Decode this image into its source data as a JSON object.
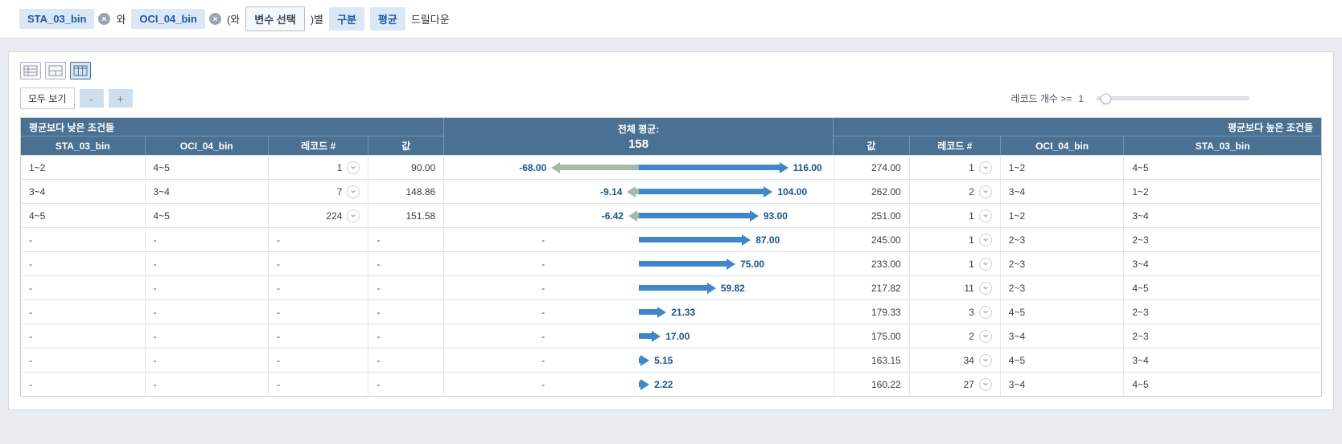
{
  "query_bar": {
    "variables": [
      {
        "label": "STA_03_bin"
      },
      {
        "label": "OCI_04_bin"
      }
    ],
    "conjunction": "와",
    "open_paren": "(와",
    "variable_select_label": "변수 선택",
    "close_paren_suffix": ")별",
    "split_label": "구분",
    "aggregate_label": "평균",
    "mode_label": "드릴다운"
  },
  "toolbar": {
    "view_all_label": "모두 보기",
    "zoom_out_label": "-",
    "zoom_in_label": "+",
    "record_filter_label": "레코드 개수 >=",
    "record_filter_value": "1"
  },
  "view_switcher": {
    "icons": [
      "table-view-icon",
      "split-view-icon",
      "column-view-icon"
    ],
    "selected_index": 2
  },
  "table": {
    "left_group_title": "평균보다 낮은 조건들",
    "right_group_title": "평균보다 높은 조건들",
    "center_header_title": "전체 평균:",
    "center_header_value": "158",
    "left_columns": [
      "STA_03_bin",
      "OCI_04_bin",
      "레코드 #",
      "값"
    ],
    "right_columns": [
      "값",
      "레코드 #",
      "OCI_04_bin",
      "STA_03_bin"
    ],
    "rows": [
      {
        "left": [
          "1~2",
          "4~5",
          "1",
          "90.00"
        ],
        "neg": "-68.00",
        "pos": "116.00",
        "right": [
          "274.00",
          "1",
          "1~2",
          "4~5"
        ]
      },
      {
        "left": [
          "3~4",
          "3~4",
          "7",
          "148.86"
        ],
        "neg": "-9.14",
        "pos": "104.00",
        "right": [
          "262.00",
          "2",
          "3~4",
          "1~2"
        ]
      },
      {
        "left": [
          "4~5",
          "4~5",
          "224",
          "151.58"
        ],
        "neg": "-6.42",
        "pos": "93.00",
        "right": [
          "251.00",
          "1",
          "1~2",
          "3~4"
        ]
      },
      {
        "left": [
          "-",
          "-",
          "-",
          "-"
        ],
        "neg": "-",
        "pos": "87.00",
        "right": [
          "245.00",
          "1",
          "2~3",
          "2~3"
        ]
      },
      {
        "left": [
          "-",
          "-",
          "-",
          "-"
        ],
        "neg": "-",
        "pos": "75.00",
        "right": [
          "233.00",
          "1",
          "2~3",
          "3~4"
        ]
      },
      {
        "left": [
          "-",
          "-",
          "-",
          "-"
        ],
        "neg": "-",
        "pos": "59.82",
        "right": [
          "217.82",
          "11",
          "2~3",
          "4~5"
        ]
      },
      {
        "left": [
          "-",
          "-",
          "-",
          "-"
        ],
        "neg": "-",
        "pos": "21.33",
        "right": [
          "179.33",
          "3",
          "4~5",
          "2~3"
        ]
      },
      {
        "left": [
          "-",
          "-",
          "-",
          "-"
        ],
        "neg": "-",
        "pos": "17.00",
        "right": [
          "175.00",
          "2",
          "3~4",
          "2~3"
        ]
      },
      {
        "left": [
          "-",
          "-",
          "-",
          "-"
        ],
        "neg": "-",
        "pos": "5.15",
        "right": [
          "163.15",
          "34",
          "4~5",
          "3~4"
        ]
      },
      {
        "left": [
          "-",
          "-",
          "-",
          "-"
        ],
        "neg": "-",
        "pos": "2.22",
        "right": [
          "160.22",
          "27",
          "3~4",
          "4~5"
        ]
      }
    ]
  },
  "colors": {
    "header_bg": "#4a7092",
    "positive_bar": "#3f87c6",
    "negative_bar": "#a5b9ab",
    "bar_label": "#17568c",
    "chip_bg": "#d9e7f6",
    "chip_text": "#1d5a9e"
  }
}
